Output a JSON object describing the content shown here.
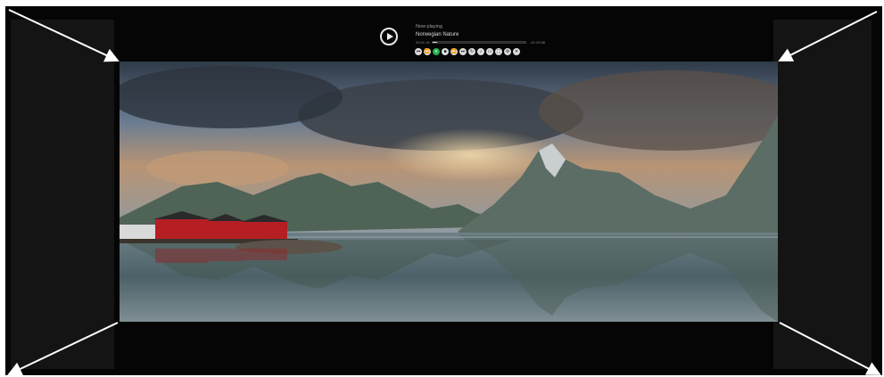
{
  "player": {
    "now_playing_label": "Now playing",
    "track_title": "Norwegian Nature",
    "time_elapsed": "00:01:16",
    "time_total": "-01:19:58",
    "progress": 0.05,
    "accent_color": "#27b24a",
    "controls": [
      {
        "name": "skip-back-icon",
        "glyph": "⏮"
      },
      {
        "name": "rewind-icon",
        "glyph": "⏪"
      },
      {
        "name": "pause-icon",
        "glyph": "⏸",
        "active": true
      },
      {
        "name": "stop-icon",
        "glyph": "■"
      },
      {
        "name": "fast-forward-icon",
        "glyph": "⏩"
      },
      {
        "name": "skip-forward-icon",
        "glyph": "⏭"
      },
      {
        "name": "repeat-icon",
        "glyph": "↻"
      },
      {
        "name": "volume-icon",
        "glyph": "♪"
      },
      {
        "name": "subtitles-icon",
        "glyph": "▭"
      },
      {
        "name": "fullscreen-icon",
        "glyph": "⛶"
      },
      {
        "name": "settings-icon",
        "glyph": "⚙"
      },
      {
        "name": "close-icon",
        "glyph": "✕"
      }
    ]
  },
  "scene": {
    "description_icon": "landscape-photo",
    "colors": {
      "sky_top": "#3e4a5c",
      "sky_light": "#8fa3b8",
      "cloud_warm": "#c9a27a",
      "mountain": "#4f5f55",
      "water": "#566a70",
      "house": "#b51f24"
    }
  }
}
